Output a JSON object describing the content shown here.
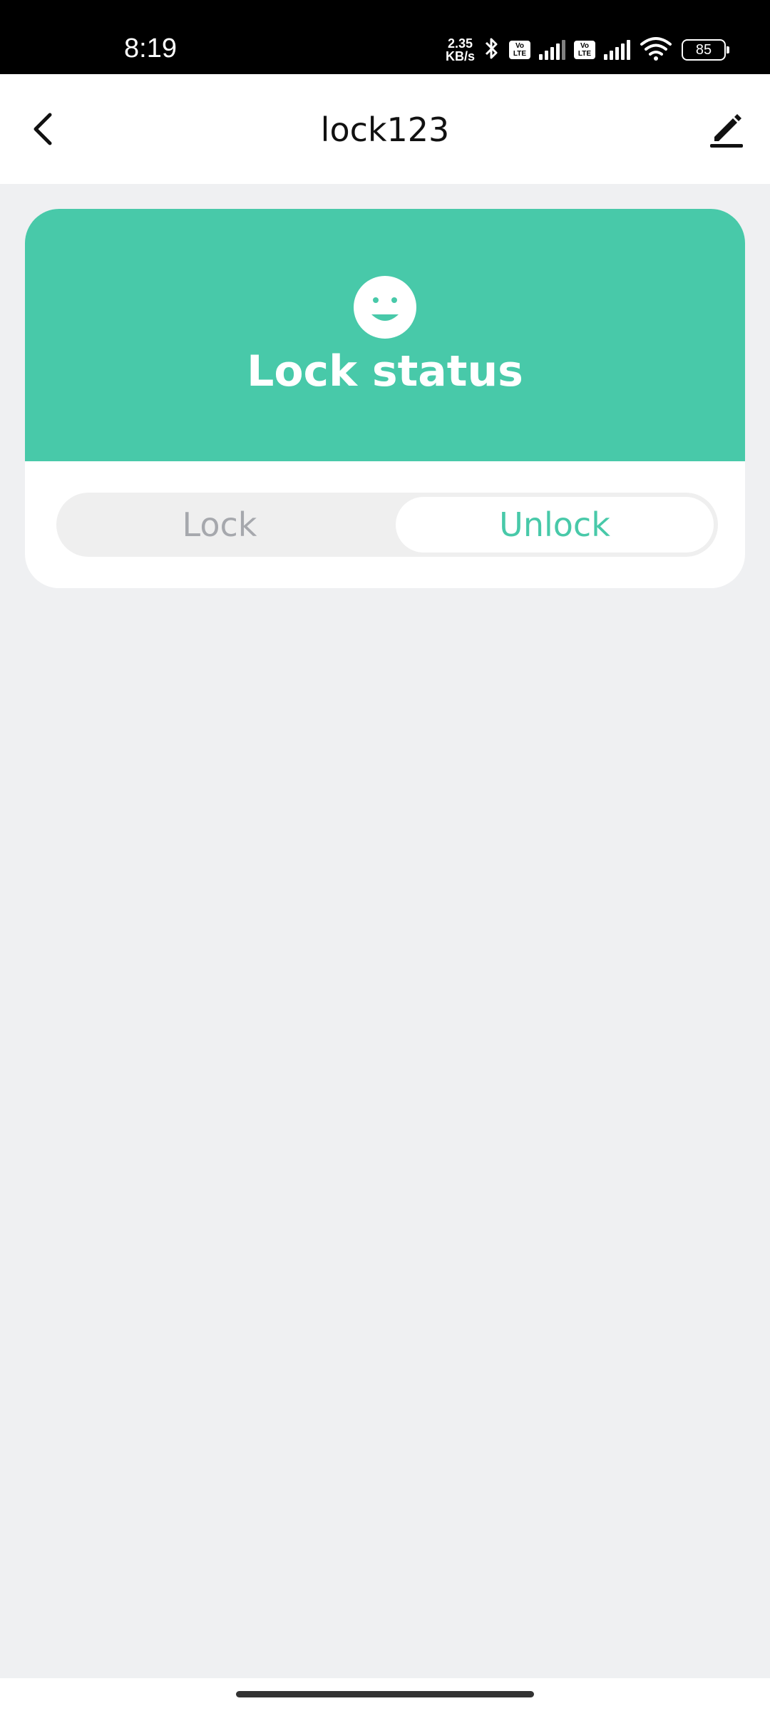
{
  "status_bar": {
    "time": "8:19",
    "net_speed_value": "2.35",
    "net_speed_unit": "KB/s",
    "volte_1": "Vo LTE",
    "volte_2": "Vo LTE",
    "battery": "85"
  },
  "header": {
    "title": "lock123"
  },
  "card": {
    "status_title": "Lock status",
    "accent_color": "#48c9a9",
    "segments": [
      {
        "label": "Lock",
        "selected": false
      },
      {
        "label": "Unlock",
        "selected": true
      }
    ]
  }
}
